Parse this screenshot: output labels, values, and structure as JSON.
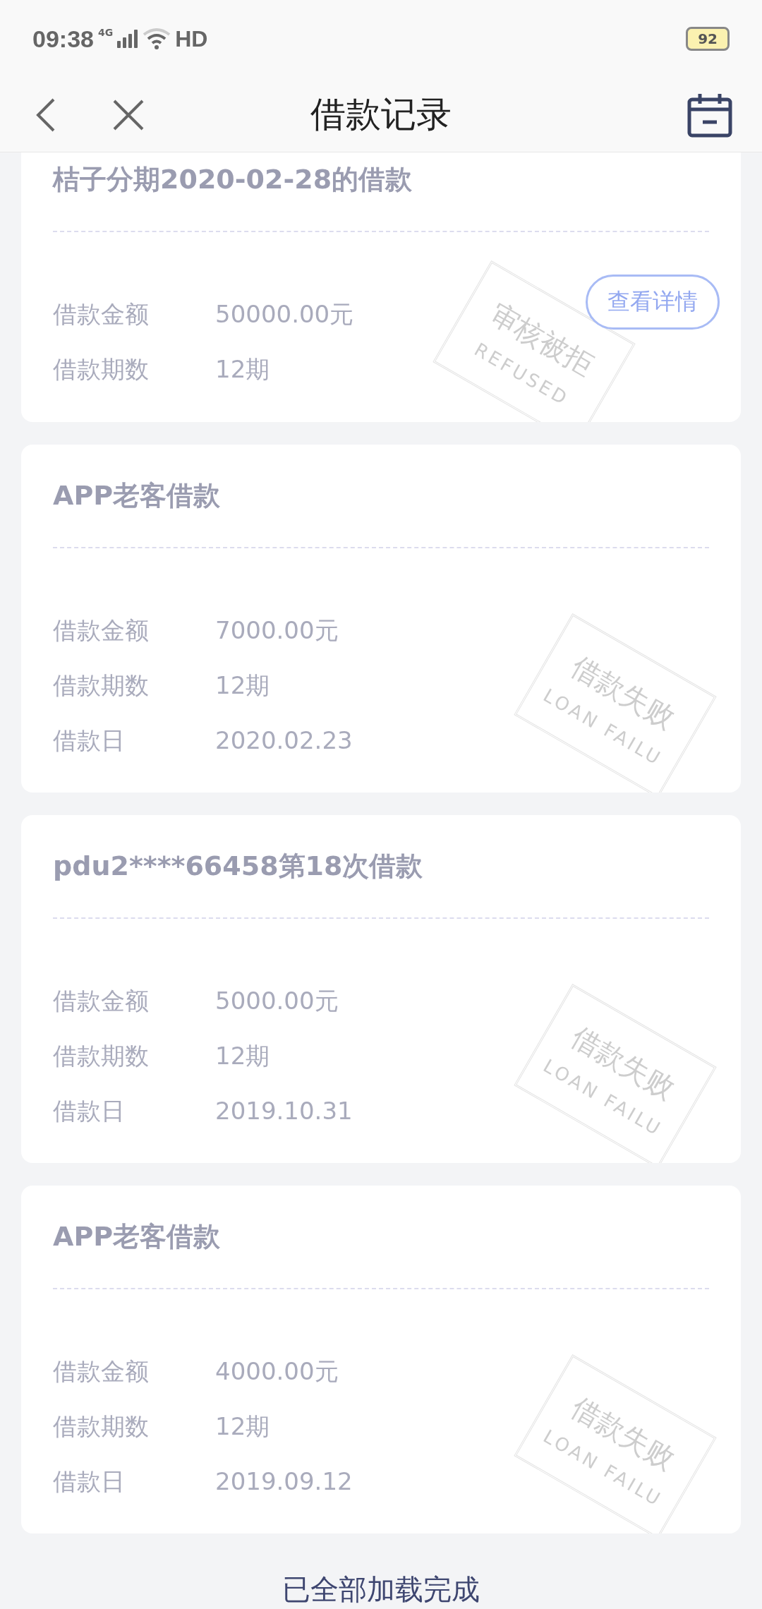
{
  "status_bar": {
    "time": "09:38",
    "network": "4G",
    "hd": "HD",
    "battery": "92"
  },
  "header": {
    "title": "借款记录"
  },
  "loans": [
    {
      "title": "桔子分期2020-02-28的借款",
      "fields": [
        {
          "label": "借款金额",
          "value": "50000.00元"
        },
        {
          "label": "借款期数",
          "value": "12期"
        }
      ],
      "button": "查看详情",
      "stamp": {
        "title": "审核被拒",
        "subtitle": "REFUSED"
      }
    },
    {
      "title": "APP老客借款",
      "fields": [
        {
          "label": "借款金额",
          "value": "7000.00元"
        },
        {
          "label": "借款期数",
          "value": "12期"
        },
        {
          "label": "借款日",
          "value": "2020.02.23"
        }
      ],
      "stamp": {
        "title": "借款失败",
        "subtitle": "LOAN FAILU"
      }
    },
    {
      "title": "pdu2****66458第18次借款",
      "fields": [
        {
          "label": "借款金额",
          "value": "5000.00元"
        },
        {
          "label": "借款期数",
          "value": "12期"
        },
        {
          "label": "借款日",
          "value": "2019.10.31"
        }
      ],
      "stamp": {
        "title": "借款失败",
        "subtitle": "LOAN FAILU"
      }
    },
    {
      "title": "APP老客借款",
      "fields": [
        {
          "label": "借款金额",
          "value": "4000.00元"
        },
        {
          "label": "借款期数",
          "value": "12期"
        },
        {
          "label": "借款日",
          "value": "2019.09.12"
        }
      ],
      "stamp": {
        "title": "借款失败",
        "subtitle": "LOAN FAILU"
      }
    }
  ],
  "footer": "已全部加载完成"
}
